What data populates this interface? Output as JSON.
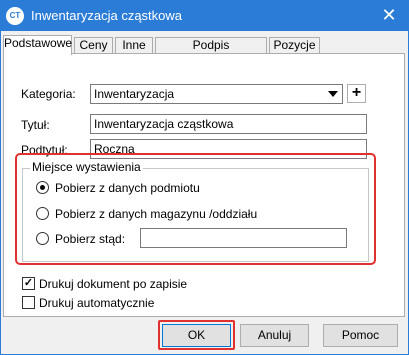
{
  "window": {
    "title": "Inwentaryzacja cząstkowa",
    "app_icon_text": "CT",
    "close_glyph": "✕"
  },
  "tabs": [
    {
      "label": "Podstawowe",
      "active": true
    },
    {
      "label": "Ceny",
      "active": false
    },
    {
      "label": "Inne",
      "active": false
    },
    {
      "label": "Podpis elektroniczny",
      "active": false
    },
    {
      "label": "Pozycje",
      "active": false
    }
  ],
  "form": {
    "kategoria_label": "Kategoria:",
    "kategoria_value": "Inwentaryzacja",
    "plus_glyph": "+",
    "tytul_label": "Tytuł:",
    "tytul_value": "Inwentaryzacja cząstkowa",
    "podtytul_label": "Podtytuł:",
    "podtytul_value": "Roczna"
  },
  "miejsce": {
    "legend": "Miejsce wystawienia",
    "options": [
      {
        "label": "Pobierz z danych podmiotu",
        "selected": true
      },
      {
        "label": "Pobierz z danych magazynu /oddziału",
        "selected": false
      },
      {
        "label": "Pobierz stąd:",
        "selected": false
      }
    ],
    "stad_value": ""
  },
  "checks": [
    {
      "label": "Drukuj dokument po zapisie",
      "checked": true,
      "glyph": "✓"
    },
    {
      "label": "Drukuj automatycznie",
      "checked": false,
      "glyph": ""
    }
  ],
  "buttons": {
    "ok": "OK",
    "anuluj": "Anuluj",
    "pomoc": "Pomoc"
  },
  "colors": {
    "title_bar": "#2b7cd6",
    "highlight": "#e03131"
  }
}
